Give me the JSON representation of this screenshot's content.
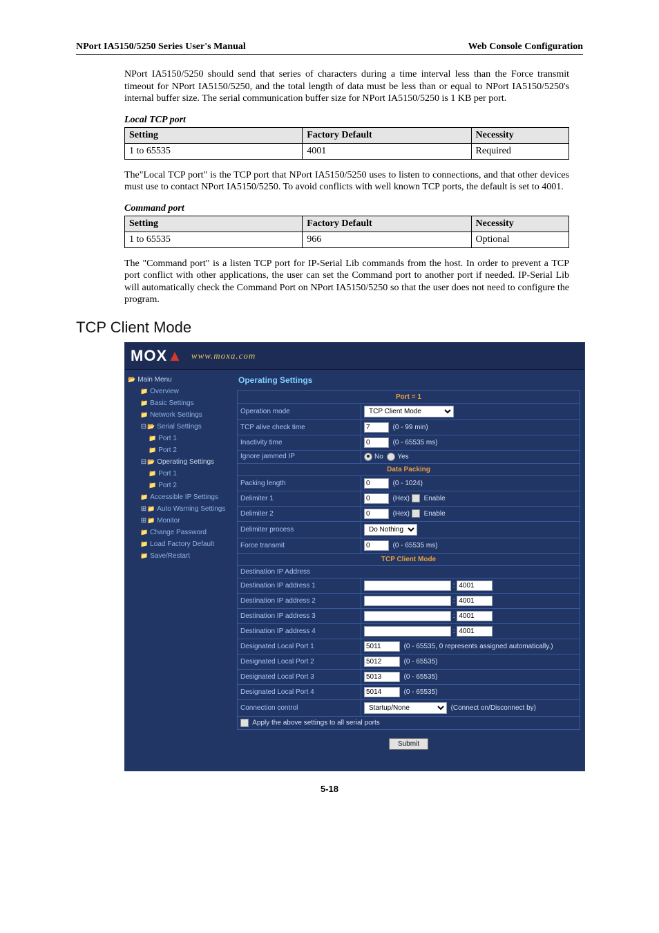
{
  "header": {
    "left": "NPort IA5150/5250 Series User's Manual",
    "right": "Web Console Configuration"
  },
  "paragraphs": {
    "p1": "NPort IA5150/5250 should send that series of characters during a time interval less than the Force transmit timeout for NPort IA5150/5250, and the total length of data must be less than or equal to NPort IA5150/5250's internal buffer size. The serial communication buffer size for NPort IA5150/5250 is 1 KB per port.",
    "h_local": "Local TCP port",
    "p2": "The\"Local TCP port\" is the TCP port that NPort IA5150/5250 uses to listen to connections, and that other devices must use to contact NPort IA5150/5250. To avoid conflicts with well known TCP ports, the default is set to 4001.",
    "h_cmd": "Command port",
    "p3": "The \"Command port\" is a listen TCP port for IP-Serial Lib commands from the host. In order to prevent a TCP port conflict with other applications, the user can set the Command port to another port if needed. IP-Serial Lib will automatically check the Command Port on NPort IA5150/5250 so that the user does not need to configure the program."
  },
  "doc_tables": {
    "cols": {
      "c1": "Setting",
      "c2": "Factory Default",
      "c3": "Necessity"
    },
    "local": {
      "setting": "1 to 65535",
      "default": "4001",
      "necessity": "Required"
    },
    "cmd": {
      "setting": "1 to 65535",
      "default": "966",
      "necessity": "Optional"
    }
  },
  "section_heading": "TCP Client Mode",
  "page_number": "5-18",
  "console": {
    "logo_url": "www.moxa.com",
    "sidebar": {
      "main": "Main Menu",
      "overview": "Overview",
      "basic": "Basic Settings",
      "network": "Network Settings",
      "serial": "Serial Settings",
      "port1": "Port 1",
      "port2": "Port 2",
      "operating": "Operating Settings",
      "accessible": "Accessible IP Settings",
      "autowarn": "Auto Warning Settings",
      "monitor": "Monitor",
      "changepwd": "Change Password",
      "loadfactory": "Load Factory Default",
      "saverestart": "Save/Restart"
    },
    "main_title": "Operating Settings",
    "sections": {
      "port_eq": "Port = 1",
      "data_packing": "Data Packing",
      "tcp_client_mode": "TCP Client Mode",
      "dest_ip_sub": "Destination IP Address"
    },
    "labels": {
      "op_mode": "Operation mode",
      "alive_check": "TCP alive check time",
      "inactivity": "Inactivity time",
      "ignore_jammed": "Ignore jammed IP",
      "packing_length": "Packing length",
      "delim1": "Delimiter 1",
      "delim2": "Delimiter 2",
      "delim_process": "Delimiter process",
      "force_transmit": "Force transmit",
      "dest1": "Destination IP address 1",
      "dest2": "Destination IP address 2",
      "dest3": "Destination IP address 3",
      "dest4": "Destination IP address 4",
      "local1": "Designated Local Port 1",
      "local2": "Designated Local Port 2",
      "local3": "Designated Local Port 3",
      "local4": "Designated Local Port 4",
      "conn_ctrl": "Connection control",
      "apply_all": "Apply the above settings to all serial ports"
    },
    "hints": {
      "alive": "(0 - 99 min)",
      "inactivity": "(0 - 65535 ms)",
      "packing": "(0 - 1024)",
      "hex": "(Hex)",
      "enable": "Enable",
      "force": "(0 - 65535 ms)",
      "local1": "(0 - 65535, 0 represents assigned automatically.)",
      "localrest": "(0 - 65535)",
      "conn_ctrl": "(Connect on/Disconnect by)",
      "no": "No",
      "yes": "Yes"
    },
    "values": {
      "op_mode_sel": "TCP Client Mode",
      "alive": "7",
      "inactivity": "0",
      "packing": "0",
      "delim1": "0",
      "delim2": "0",
      "delim_process_sel": "Do Nothing",
      "force": "0",
      "dest_port1": "4001",
      "dest_port2": "4001",
      "dest_port3": "4001",
      "dest_port4": "4001",
      "local1": "5011",
      "local2": "5012",
      "local3": "5013",
      "local4": "5014",
      "conn_ctrl_sel": "Startup/None",
      "colon": ":"
    },
    "submit": "Submit"
  }
}
